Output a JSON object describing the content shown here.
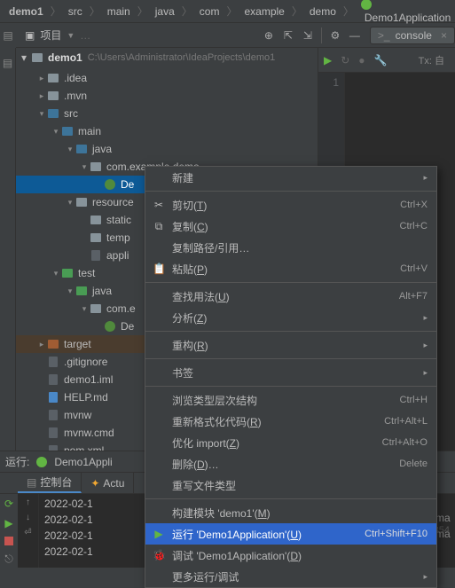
{
  "breadcrumb": [
    "demo1",
    "src",
    "main",
    "java",
    "com",
    "example",
    "demo",
    "Demo1Application"
  ],
  "project_label": "项目",
  "console_tab": "console",
  "tx_label": "Tx: 自",
  "tree": {
    "root_name": "demo1",
    "root_path": "C:\\Users\\Administrator\\IdeaProjects\\demo1",
    "items": [
      {
        "depth": 1,
        "arrow": "right",
        "icon": "folder",
        "label": ".idea"
      },
      {
        "depth": 1,
        "arrow": "right",
        "icon": "folder",
        "label": ".mvn"
      },
      {
        "depth": 1,
        "arrow": "down",
        "icon": "folder-src",
        "label": "src"
      },
      {
        "depth": 2,
        "arrow": "down",
        "icon": "folder-src",
        "label": "main"
      },
      {
        "depth": 3,
        "arrow": "down",
        "icon": "folder-src",
        "label": "java"
      },
      {
        "depth": 4,
        "arrow": "down",
        "icon": "folder",
        "label": "com.example.demo"
      },
      {
        "depth": 5,
        "arrow": "",
        "icon": "class",
        "label": "De",
        "selected": true
      },
      {
        "depth": 3,
        "arrow": "down",
        "icon": "folder",
        "label": "resource"
      },
      {
        "depth": 4,
        "arrow": "",
        "icon": "folder",
        "label": "static"
      },
      {
        "depth": 4,
        "arrow": "",
        "icon": "folder",
        "label": "temp"
      },
      {
        "depth": 4,
        "arrow": "",
        "icon": "file",
        "label": "appli"
      },
      {
        "depth": 2,
        "arrow": "down",
        "icon": "folder-test",
        "label": "test"
      },
      {
        "depth": 3,
        "arrow": "down",
        "icon": "folder-test",
        "label": "java"
      },
      {
        "depth": 4,
        "arrow": "down",
        "icon": "folder",
        "label": "com.e"
      },
      {
        "depth": 5,
        "arrow": "",
        "icon": "class",
        "label": "De"
      },
      {
        "depth": 1,
        "arrow": "right",
        "icon": "folder-excl",
        "label": "target",
        "target": true
      },
      {
        "depth": 1,
        "arrow": "",
        "icon": "file",
        "label": ".gitignore"
      },
      {
        "depth": 1,
        "arrow": "",
        "icon": "file",
        "label": "demo1.iml"
      },
      {
        "depth": 1,
        "arrow": "",
        "icon": "file-md",
        "label": "HELP.md"
      },
      {
        "depth": 1,
        "arrow": "",
        "icon": "file",
        "label": "mvnw"
      },
      {
        "depth": 1,
        "arrow": "",
        "icon": "file",
        "label": "mvnw.cmd"
      },
      {
        "depth": 1,
        "arrow": "",
        "icon": "file",
        "label": "pom.xml"
      }
    ]
  },
  "editor": {
    "line_num": "1"
  },
  "ctx": {
    "items": [
      {
        "label": "新建",
        "sub": true
      },
      {
        "sep": true
      },
      {
        "icon": "cut",
        "label": "剪切(T)",
        "shortcut": "Ctrl+X"
      },
      {
        "icon": "copy",
        "label": "复制(C)",
        "shortcut": "Ctrl+C"
      },
      {
        "label": "复制路径/引用…"
      },
      {
        "icon": "paste",
        "label": "粘贴(P)",
        "shortcut": "Ctrl+V"
      },
      {
        "sep": true
      },
      {
        "label": "查找用法(U)",
        "shortcut": "Alt+F7"
      },
      {
        "label": "分析(Z)",
        "sub": true
      },
      {
        "sep": true
      },
      {
        "label": "重构(R)",
        "sub": true
      },
      {
        "sep": true
      },
      {
        "label": "书签",
        "sub": true
      },
      {
        "sep": true
      },
      {
        "label": "浏览类型层次结构",
        "shortcut": "Ctrl+H"
      },
      {
        "label": "重新格式化代码(R)",
        "shortcut": "Ctrl+Alt+L"
      },
      {
        "label": "优化 import(Z)",
        "shortcut": "Ctrl+Alt+O"
      },
      {
        "label": "删除(D)…",
        "shortcut": "Delete"
      },
      {
        "label": "重写文件类型"
      },
      {
        "sep": true
      },
      {
        "label": "构建模块 'demo1'(M)"
      },
      {
        "icon": "play",
        "label": "运行 'Demo1Application'(U)",
        "shortcut": "Ctrl+Shift+F10",
        "hl": true
      },
      {
        "icon": "bug",
        "label": "调试 'Demo1Application'(D)"
      },
      {
        "label": "更多运行/调试",
        "sub": true
      }
    ]
  },
  "run": {
    "label": "运行:",
    "config": "Demo1Appli",
    "tab1": "控制台",
    "tab2": "Actu",
    "lines": [
      "2022-02-1",
      "2022-02-1",
      "2022-02-1",
      "2022-02-1"
    ],
    "side_labels": [
      "ma",
      "ma"
    ]
  },
  "watermark": "CSDN @weixin_45797354"
}
